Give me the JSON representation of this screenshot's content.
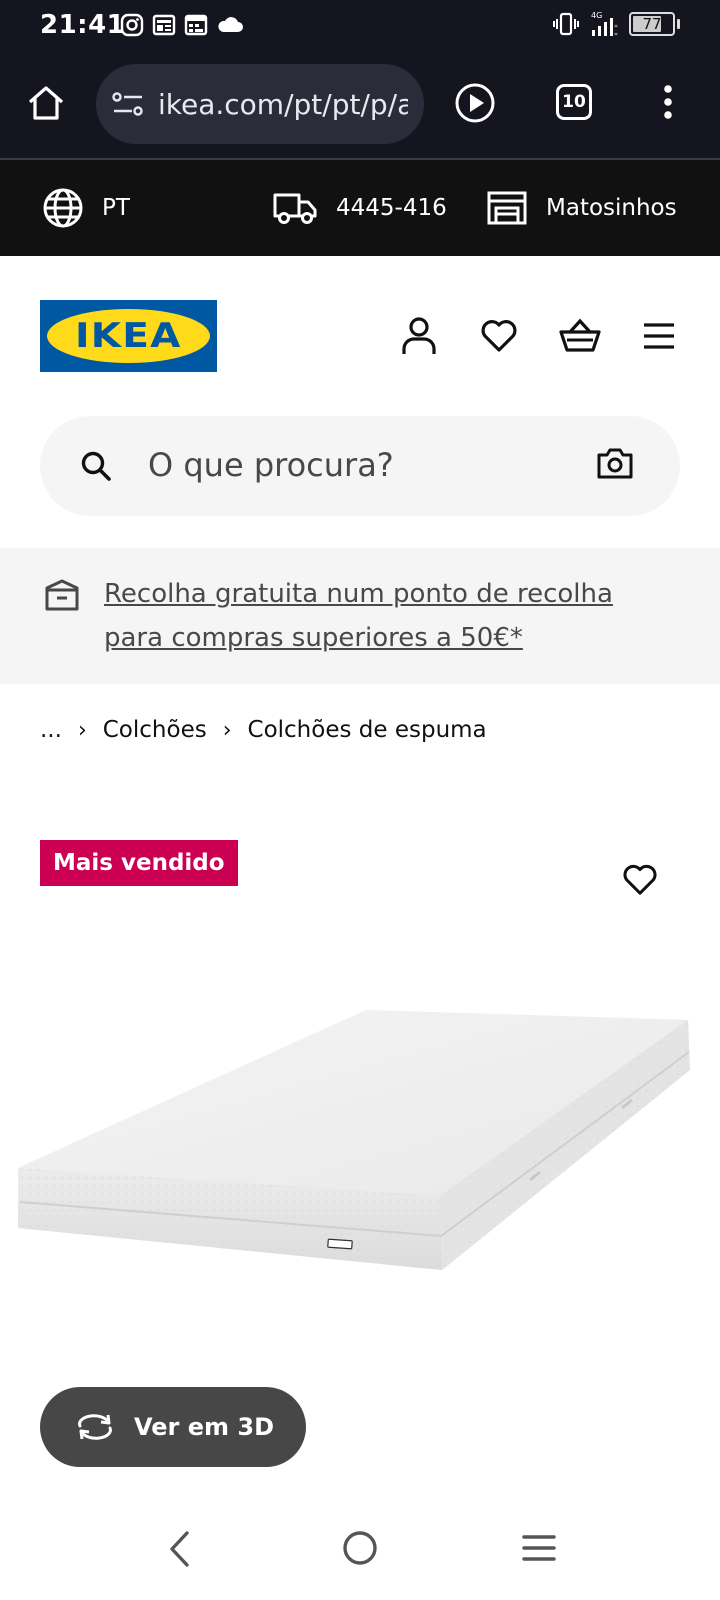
{
  "status_bar": {
    "time": "21:41",
    "left_icons": [
      "instagram-icon",
      "news-icon",
      "calendar-icon",
      "cloud-icon"
    ],
    "network": "4G",
    "battery": "77",
    "battery_level": 0.77
  },
  "browser": {
    "url": "ikea.com/pt/pt/p/a",
    "tab_count": "10"
  },
  "locale_bar": {
    "language": "PT",
    "postal_code": "4445-416",
    "store": "Matosinhos"
  },
  "header": {
    "logo_text": "IKEA",
    "brand_colors": {
      "blue": "#0058a3",
      "yellow": "#ffda1a"
    }
  },
  "search": {
    "placeholder": "O que procura?"
  },
  "banner": {
    "line1": "Recolha gratuita num ponto de recolha",
    "line2": "para compras superiores a 50€*"
  },
  "breadcrumb": {
    "items": [
      "...",
      "Colchões",
      "Colchões de espuma"
    ]
  },
  "product": {
    "badge": "Mais vendido",
    "badge_color": "#cc0053",
    "view_3d_label": "Ver em 3D"
  }
}
